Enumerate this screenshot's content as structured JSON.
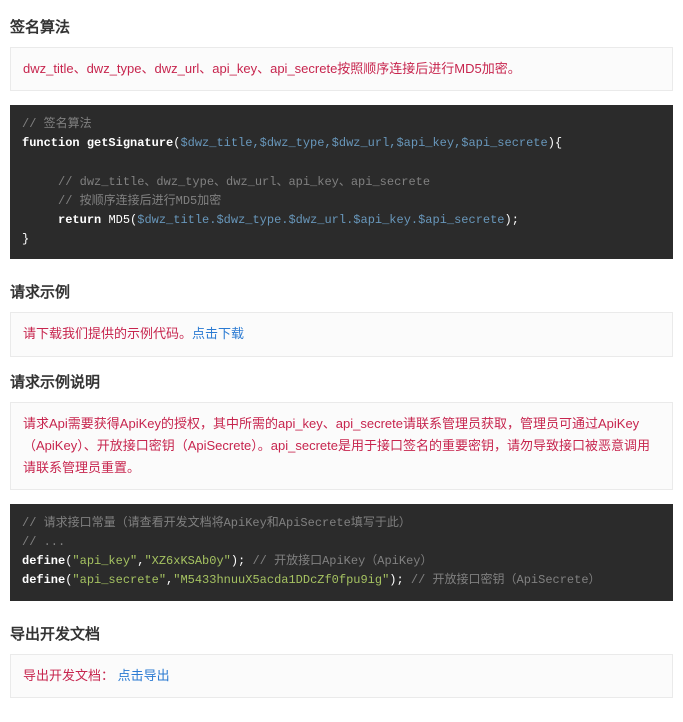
{
  "sections": {
    "signAlgo": {
      "heading": "签名算法",
      "notice": "dwz_title、dwz_type、dwz_url、api_key、api_secrete按照顺序连接后进行MD5加密。",
      "code": {
        "c1": "// 签名算法",
        "kw_function": "function",
        "funcname": "getSignature",
        "paren_open": "(",
        "params": "$dwz_title,$dwz_type,$dwz_url,$api_key,$api_secrete",
        "paren_close_brace": "){",
        "c2": "// dwz_title、dwz_type、dwz_url、api_key、api_secrete",
        "c3": "// 按顺序连接后进行MD5加密",
        "kw_return": "return",
        "md5_call": "MD5(",
        "md5_args": "$dwz_title.$dwz_type.$dwz_url.$api_key.$api_secrete",
        "md5_close": ");",
        "close_brace": "}"
      }
    },
    "reqExample": {
      "heading": "请求示例",
      "notice_prefix": "请下载我们提供的示例代码。",
      "notice_link": "点击下载"
    },
    "reqExplain": {
      "heading": "请求示例说明",
      "notice": "请求Api需要获得ApiKey的授权，其中所需的api_key、api_secrete请联系管理员获取，管理员可通过ApiKey（ApiKey）、开放接口密钥（ApiSecrete）。api_secrete是用于接口签名的重要密钥，请勿导致接口被恶意调用请联系管理员重置。",
      "code": {
        "c1": "// 请求接口常量（请查看开发文档将ApiKey和ApiSecrete填写于此）",
        "c2": "// ...",
        "define1_kw": "define",
        "define1_args_open": "(",
        "define1_key": "\"api_key\"",
        "define1_comma": ",",
        "define1_val": "\"XZ6xKSAb0y\"",
        "define1_close": ");",
        "define1_comment": " // 开放接口ApiKey（ApiKey）",
        "define2_kw": "define",
        "define2_args_open": "(",
        "define2_key": "\"api_secrete\"",
        "define2_comma": ",",
        "define2_val": "\"M5433hnuuX5acda1DDcZf0fpu9ig\"",
        "define2_close": ");",
        "define2_comment": " // 开放接口密钥（ApiSecrete）"
      }
    },
    "exportDoc": {
      "heading": "导出开发文档",
      "notice_prefix": "导出开发文档：",
      "notice_link": "点击导出"
    }
  }
}
